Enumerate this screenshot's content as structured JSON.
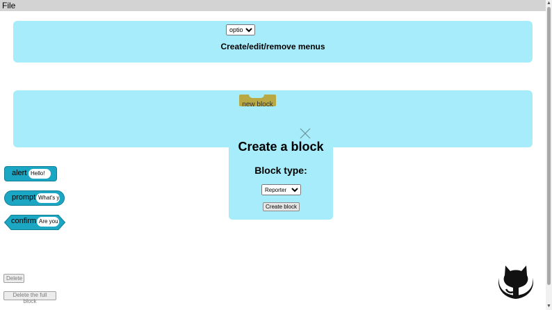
{
  "menubar": {
    "file_label": "File"
  },
  "menus_panel": {
    "select_value": "option",
    "title": "Create/edit/remove menus"
  },
  "blocks_panel": {
    "new_block_label": "new block"
  },
  "modal": {
    "title": "Create a block",
    "subtitle": "Block type:",
    "type_value": "Reporter",
    "create_label": "Create block"
  },
  "palette": {
    "alert": {
      "name": "alert",
      "input": "Hello!"
    },
    "prompt": {
      "name": "prompt",
      "input": "What's y"
    },
    "confirm": {
      "name": "confirm",
      "input": "Are you"
    }
  },
  "buttons": {
    "delete_label": "Delete",
    "delete_full_label": "Delete the full block"
  },
  "colors": {
    "panel_bg": "#a6ecfb",
    "block_blue": "#1ba7c3",
    "block_olive": "#b8a944"
  },
  "icons": {
    "github": "github-octocat-icon",
    "close": "close-icon"
  }
}
